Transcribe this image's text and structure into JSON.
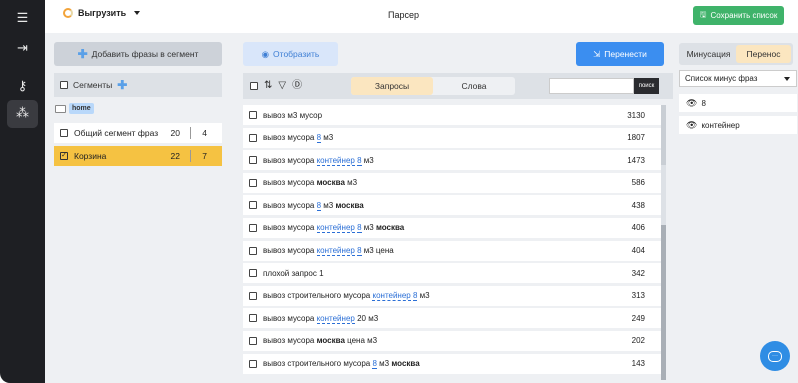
{
  "nav": {
    "menu_icon": "hamburger-icon",
    "items": [
      "login-icon",
      "key-icon",
      "sitemap-icon"
    ]
  },
  "header": {
    "export_label": "Выгрузить",
    "title": "Парсер",
    "save_label": "Сохранить список"
  },
  "left": {
    "add_phrases_label": "Добавить фразы в сегмент",
    "segments_label": "Сегменты",
    "folder_tag": "home",
    "segments": [
      {
        "label": "Общий сегмент фраз",
        "count1": "20",
        "count2": "4",
        "active": false
      },
      {
        "label": "Корзина",
        "count1": "22",
        "count2": "7",
        "active": true
      }
    ]
  },
  "middle": {
    "show_label": "Отобразить",
    "move_label": "Перенести",
    "tabs": [
      "Запросы",
      "Слова"
    ],
    "search_button": "поиск",
    "rows": [
      {
        "parts": [
          [
            "вывоз м3 мусор",
            ""
          ]
        ],
        "count": "3130"
      },
      {
        "parts": [
          [
            "вывоз мусора ",
            ""
          ],
          [
            "8",
            "hl"
          ],
          [
            " м3",
            ""
          ]
        ],
        "count": "1807"
      },
      {
        "parts": [
          [
            "вывоз мусора ",
            ""
          ],
          [
            "контейнер",
            "hl"
          ],
          [
            " ",
            ""
          ],
          [
            "8",
            "hl"
          ],
          [
            " м3",
            ""
          ]
        ],
        "count": "1473"
      },
      {
        "parts": [
          [
            "вывоз мусора ",
            ""
          ],
          [
            "москва",
            "b"
          ],
          [
            " м3",
            ""
          ]
        ],
        "count": "586"
      },
      {
        "parts": [
          [
            "вывоз мусора ",
            ""
          ],
          [
            "8",
            "hl"
          ],
          [
            " м3 ",
            ""
          ],
          [
            "москва",
            "b"
          ]
        ],
        "count": "438"
      },
      {
        "parts": [
          [
            "вывоз мусора ",
            ""
          ],
          [
            "контейнер",
            "hl"
          ],
          [
            " ",
            ""
          ],
          [
            "8",
            "hl"
          ],
          [
            " м3 ",
            ""
          ],
          [
            "москва",
            "b"
          ]
        ],
        "count": "406"
      },
      {
        "parts": [
          [
            "вывоз мусора ",
            ""
          ],
          [
            "контейнер",
            "hl"
          ],
          [
            " ",
            ""
          ],
          [
            "8",
            "hl"
          ],
          [
            " м3 цена",
            ""
          ]
        ],
        "count": "404"
      },
      {
        "parts": [
          [
            "плохой запрос 1",
            ""
          ]
        ],
        "count": "342"
      },
      {
        "parts": [
          [
            "вывоз строительного мусора ",
            ""
          ],
          [
            "контейнер",
            "hl"
          ],
          [
            " ",
            ""
          ],
          [
            "8",
            "hl"
          ],
          [
            " м3",
            ""
          ]
        ],
        "count": "313"
      },
      {
        "parts": [
          [
            "вывоз мусора ",
            ""
          ],
          [
            "контейнер",
            "hl"
          ],
          [
            " 20 м3",
            ""
          ]
        ],
        "count": "249"
      },
      {
        "parts": [
          [
            "вывоз мусора ",
            ""
          ],
          [
            "москва",
            "b"
          ],
          [
            " цена м3",
            ""
          ]
        ],
        "count": "202"
      },
      {
        "parts": [
          [
            "вывоз строительного мусора ",
            ""
          ],
          [
            "8",
            "hl"
          ],
          [
            " м3 ",
            ""
          ],
          [
            "москва",
            "b"
          ]
        ],
        "count": "143"
      }
    ]
  },
  "right": {
    "tabs": [
      "Минусация",
      "Перенос"
    ],
    "select_value": "Список минус фраз",
    "items": [
      "8",
      "контейнер"
    ]
  },
  "colors": {
    "nav_bg": "#1e1f23",
    "save_green": "#3fb36a",
    "move_blue": "#3b8ef0",
    "active_yellow": "#f5c242",
    "tab_active": "#fbe6c0"
  }
}
